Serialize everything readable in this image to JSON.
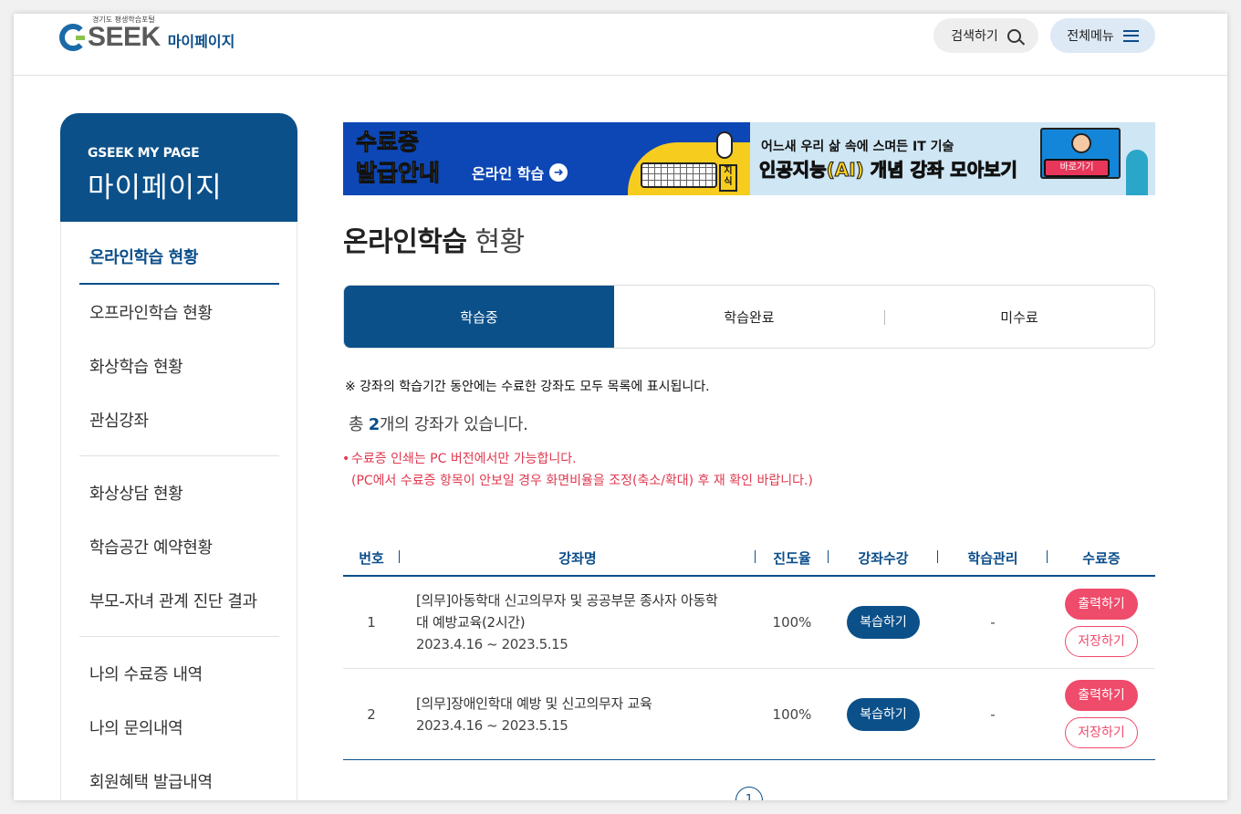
{
  "header": {
    "logo_sub": "경기도 평생학습포털",
    "logo_main": "SEEK",
    "logo_mypage": "마이페이지",
    "search_label": "검색하기",
    "menu_label": "전체메뉴"
  },
  "sidebar": {
    "title_en": "GSEEK MY PAGE",
    "title_ko": "마이페이지",
    "group1": [
      "온라인학습 현황",
      "오프라인학습 현황",
      "화상학습 현황",
      "관심강좌"
    ],
    "group2": [
      "화상상담 현황",
      "학습공간 예약현황",
      "부모-자녀 관계 진단 결과"
    ],
    "group3": [
      "나의 수료증 내역",
      "나의 문의내역",
      "회원혜택 발급내역"
    ]
  },
  "banner": {
    "left_title_1": "수료증",
    "left_title_2": "발급안내",
    "left_sub": "온라인 학습",
    "left_tag": "지식",
    "right_top": "어느새 우리 삶 속에 스며든 IT 기술",
    "right_main": "인공지능(AI) 개념 강좌 모아보기",
    "right_button": "바로가기"
  },
  "page": {
    "title_bold": "온라인학습",
    "title_light": "현황"
  },
  "tabs": [
    "학습중",
    "학습완료",
    "미수료"
  ],
  "notice": "※ 강좌의 학습기간 동안에는 수료한 강좌도 모두 목록에 표시됩니다.",
  "count": {
    "prefix": "총",
    "number": "2",
    "suffix": "개의 강좌가 있습니다."
  },
  "warning": {
    "bullet": "•",
    "line1": "수료증 인쇄는 PC 버전에서만 가능합니다.",
    "line2": "(PC에서 수료증 항목이 안보일 경우 화면비율을 조정(축소/확대) 후 재 확인 바랍니다.)"
  },
  "table": {
    "headers": [
      "번호",
      "강좌명",
      "진도율",
      "강좌수강",
      "학습관리",
      "수료증"
    ],
    "rows": [
      {
        "no": "1",
        "name_line1": "[의무]아동학대 신고의무자 및 공공부문 종사자 아동학",
        "name_line2": "대 예방교육(2시간)",
        "period": "2023.4.16 ~ 2023.5.15",
        "progress": "100%",
        "review_label": "복습하기",
        "manage": "-",
        "print_label": "출력하기",
        "save_label": "저장하기"
      },
      {
        "no": "2",
        "name_line1": "[의무]장애인학대 예방 및 신고의무자 교육",
        "name_line2": "",
        "period": "2023.4.16 ~ 2023.5.15",
        "progress": "100%",
        "review_label": "복습하기",
        "manage": "-",
        "print_label": "출력하기",
        "save_label": "저장하기"
      }
    ]
  },
  "pager": {
    "current": "1"
  },
  "colors": {
    "primary": "#0b5089",
    "accent_pink": "#ef4b6b",
    "warning_red": "#e0384f"
  }
}
